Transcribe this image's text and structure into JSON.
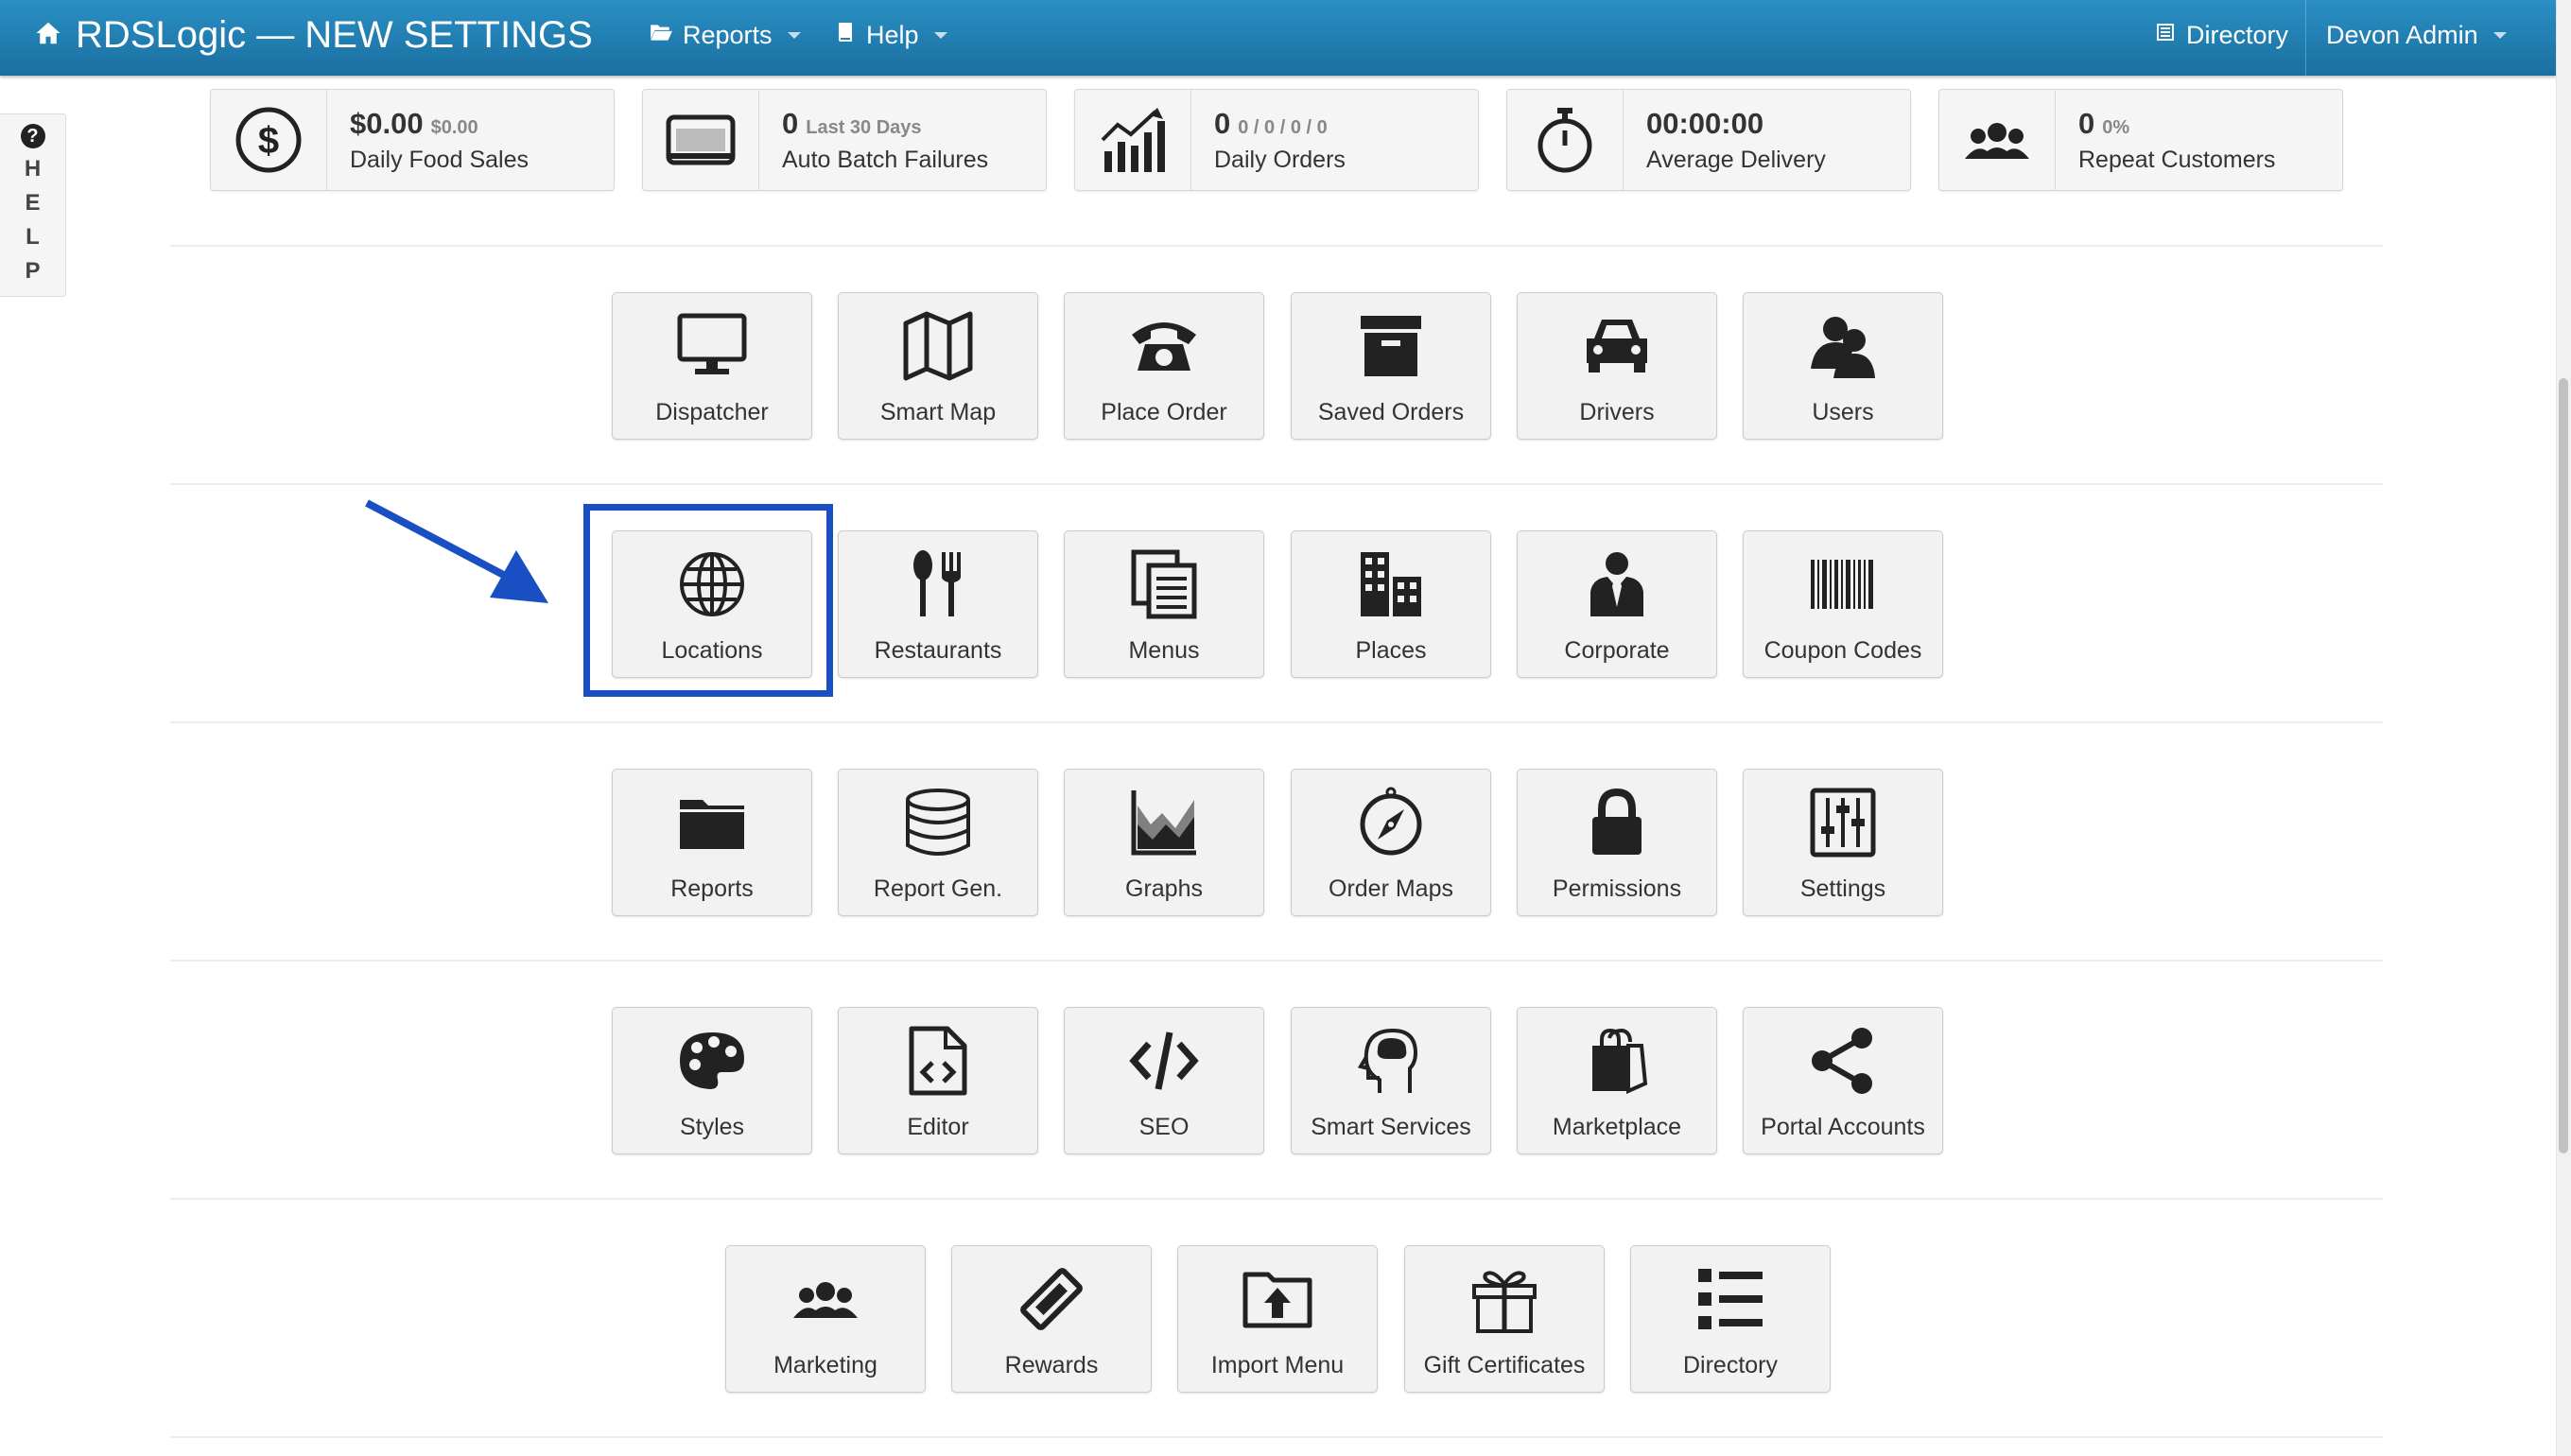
{
  "navbar": {
    "title": "RDSLogic — NEW SETTINGS",
    "reports_label": "Reports",
    "help_label": "Help",
    "directory_label": "Directory",
    "user_label": "Devon Admin"
  },
  "help_tab": {
    "question": "?",
    "letters": [
      "H",
      "E",
      "L",
      "P"
    ]
  },
  "stats": [
    {
      "value": "$0.00",
      "sub": "$0.00",
      "label": "Daily Food Sales",
      "icon": "dollar-icon"
    },
    {
      "value": "0",
      "sub": "Last 30 Days",
      "label": "Auto Batch Failures",
      "icon": "credit-card-icon"
    },
    {
      "value": "0",
      "sub": "0 / 0 / 0 / 0",
      "label": "Daily Orders",
      "icon": "chart-up-icon"
    },
    {
      "value": "00:00:00",
      "sub": "",
      "label": "Average Delivery",
      "icon": "stopwatch-icon"
    },
    {
      "value": "0",
      "sub": "0%",
      "label": "Repeat Customers",
      "icon": "group-icon"
    }
  ],
  "rows": [
    [
      {
        "label": "Dispatcher",
        "icon": "monitor-icon"
      },
      {
        "label": "Smart Map",
        "icon": "map-icon"
      },
      {
        "label": "Place Order",
        "icon": "phone-icon"
      },
      {
        "label": "Saved Orders",
        "icon": "archive-icon"
      },
      {
        "label": "Drivers",
        "icon": "car-icon"
      },
      {
        "label": "Users",
        "icon": "users-icon"
      }
    ],
    [
      {
        "label": "Locations",
        "icon": "globe-icon"
      },
      {
        "label": "Restaurants",
        "icon": "cutlery-icon"
      },
      {
        "label": "Menus",
        "icon": "documents-icon"
      },
      {
        "label": "Places",
        "icon": "buildings-icon"
      },
      {
        "label": "Corporate",
        "icon": "businessman-icon"
      },
      {
        "label": "Coupon Codes",
        "icon": "barcode-icon"
      }
    ],
    [
      {
        "label": "Reports",
        "icon": "folder-icon"
      },
      {
        "label": "Report Gen.",
        "icon": "database-icon"
      },
      {
        "label": "Graphs",
        "icon": "area-chart-icon"
      },
      {
        "label": "Order Maps",
        "icon": "compass-icon"
      },
      {
        "label": "Permissions",
        "icon": "lock-icon"
      },
      {
        "label": "Settings",
        "icon": "sliders-icon"
      }
    ],
    [
      {
        "label": "Styles",
        "icon": "palette-icon"
      },
      {
        "label": "Editor",
        "icon": "code-file-icon"
      },
      {
        "label": "SEO",
        "icon": "code-icon"
      },
      {
        "label": "Smart Services",
        "icon": "brain-head-icon"
      },
      {
        "label": "Marketplace",
        "icon": "shopping-bag-icon"
      },
      {
        "label": "Portal Accounts",
        "icon": "share-icon"
      }
    ],
    [
      {
        "label": "Marketing",
        "icon": "group-icon"
      },
      {
        "label": "Rewards",
        "icon": "ticket-icon"
      },
      {
        "label": "Import Menu",
        "icon": "folder-upload-icon"
      },
      {
        "label": "Gift Certificates",
        "icon": "gift-icon"
      },
      {
        "label": "Directory",
        "icon": "list-icon"
      }
    ]
  ],
  "annotation": {
    "highlighted_tile": "Locations"
  }
}
